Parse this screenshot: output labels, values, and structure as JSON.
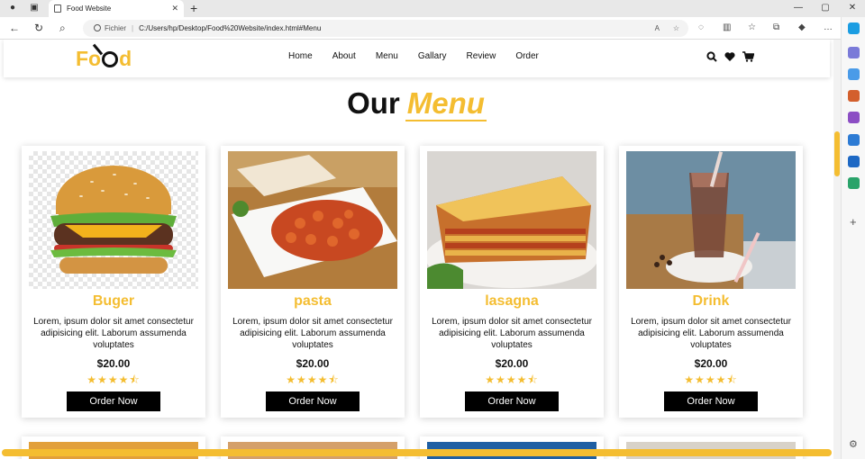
{
  "browser": {
    "tab_title": "Food Website",
    "url_prefix": "Fichier",
    "url": "C:/Users/hp/Desktop/Food%20Website/index.html#Menu"
  },
  "site": {
    "logo_left": "Fo",
    "logo_right": "d",
    "nav": [
      "Home",
      "About",
      "Menu",
      "Gallary",
      "Review",
      "Order"
    ],
    "heading_main": "Our",
    "heading_accent": "Menu"
  },
  "colors": {
    "accent": "#f4bd31",
    "button": "#000000"
  },
  "menu_items": [
    {
      "name": "Buger",
      "description": "Lorem, ipsum dolor sit amet consectetur adipisicing elit. Laborum assumenda voluptates",
      "price": "$20.00",
      "stars": "★★★★⯪",
      "button": "Order Now"
    },
    {
      "name": "pasta",
      "description": "Lorem, ipsum dolor sit amet consectetur adipisicing elit. Laborum assumenda voluptates",
      "price": "$20.00",
      "stars": "★★★★⯪",
      "button": "Order Now"
    },
    {
      "name": "lasagna",
      "description": "Lorem, ipsum dolor sit amet consectetur adipisicing elit. Laborum assumenda voluptates",
      "price": "$20.00",
      "stars": "★★★★⯪",
      "button": "Order Now"
    },
    {
      "name": "Drink",
      "description": "Lorem, ipsum dolor sit amet consectetur adipisicing elit. Laborum assumenda voluptates",
      "price": "$20.00",
      "stars": "★★★★⯪",
      "button": "Order Now"
    }
  ]
}
